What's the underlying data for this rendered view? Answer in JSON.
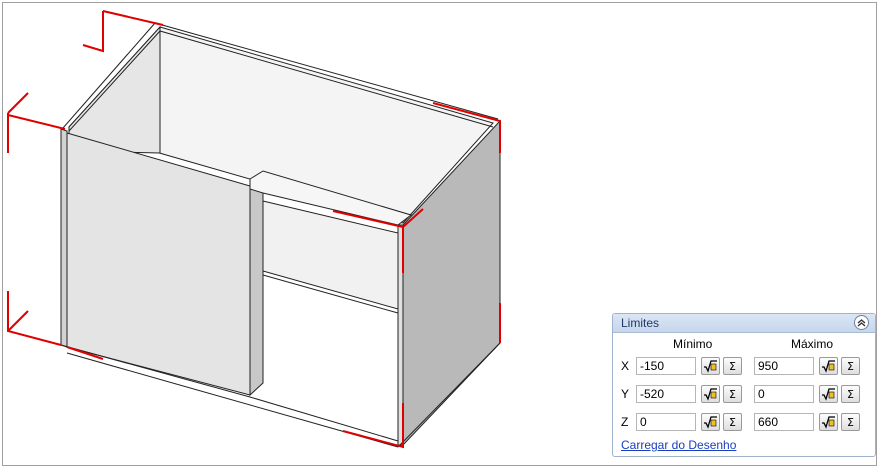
{
  "panel": {
    "title": "Limites",
    "col_min": "Mínimo",
    "col_max": "Máximo",
    "rows": [
      {
        "axis": "X",
        "min": "-150",
        "max": "950"
      },
      {
        "axis": "Y",
        "min": "-520",
        "max": "0"
      },
      {
        "axis": "Z",
        "min": "0",
        "max": "660"
      }
    ],
    "load_link": "Carregar do Desenho"
  },
  "colors": {
    "limit_lines": "#e00000",
    "panel_border": "#9fb3cf",
    "link": "#1a3fbf"
  },
  "icons": [
    "collapse-up-icon",
    "sqrt-icon",
    "sigma-icon"
  ]
}
